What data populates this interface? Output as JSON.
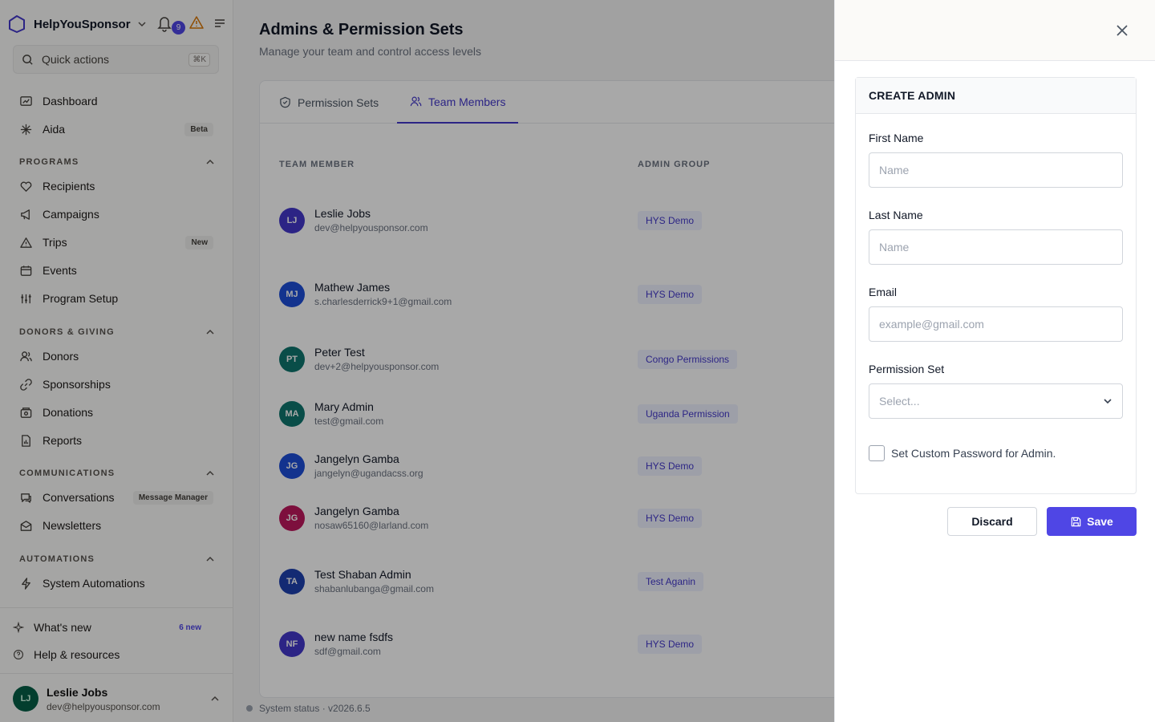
{
  "app": {
    "brand": "HelpYouSponsor",
    "notification_count": "9",
    "quick_actions": "Quick actions",
    "quick_actions_kbd": "⌘K"
  },
  "sidebar": {
    "top_items": [
      {
        "label": "Dashboard",
        "icon": "dashboard-icon"
      },
      {
        "label": "Aida",
        "icon": "sparkle-icon",
        "tag": "Beta"
      }
    ],
    "sections": [
      {
        "title": "PROGRAMS",
        "items": [
          {
            "label": "Recipients",
            "icon": "heart-icon"
          },
          {
            "label": "Campaigns",
            "icon": "megaphone-icon"
          },
          {
            "label": "Trips",
            "icon": "mountain-icon",
            "tag": "New"
          },
          {
            "label": "Events",
            "icon": "calendar-icon"
          },
          {
            "label": "Program Setup",
            "icon": "sliders-icon"
          }
        ]
      },
      {
        "title": "DONORS & GIVING",
        "items": [
          {
            "label": "Donors",
            "icon": "users-icon"
          },
          {
            "label": "Sponsorships",
            "icon": "link-icon"
          },
          {
            "label": "Donations",
            "icon": "donation-icon"
          },
          {
            "label": "Reports",
            "icon": "report-icon"
          }
        ]
      },
      {
        "title": "COMMUNICATIONS",
        "items": [
          {
            "label": "Conversations",
            "icon": "chat-icon",
            "tag": "Message Manager"
          },
          {
            "label": "Newsletters",
            "icon": "mail-icon"
          }
        ]
      },
      {
        "title": "AUTOMATIONS",
        "items": [
          {
            "label": "System Automations",
            "icon": "bolt-icon"
          }
        ]
      }
    ],
    "footer_items": [
      {
        "label": "What's new",
        "tag": "6 new"
      },
      {
        "label": "Help & resources"
      }
    ],
    "user": {
      "initials": "LJ",
      "name": "Leslie Jobs",
      "email": "dev@helpyousponsor.com"
    }
  },
  "main": {
    "title": "Admins & Permission Sets",
    "subtitle": "Manage your team and control access levels",
    "tabs": [
      {
        "label": "Permission Sets",
        "active": false
      },
      {
        "label": "Team Members",
        "active": true
      }
    ],
    "columns": [
      "TEAM MEMBER",
      "ADMIN GROUP"
    ],
    "rows": [
      {
        "initials": "LJ",
        "name": "Leslie Jobs",
        "email": "dev@helpyousponsor.com",
        "group": "HYS Demo",
        "color": "#4338ca"
      },
      {
        "initials": "MJ",
        "name": "Mathew James",
        "email": "s.charlesderrick9+1@gmail.com",
        "group": "HYS Demo",
        "color": "#1d4ed8"
      },
      {
        "initials": "PT",
        "name": "Peter Test",
        "email": "dev+2@helpyousponsor.com",
        "group": "Congo Permissions",
        "color": "#0f766e"
      },
      {
        "initials": "MA",
        "name": "Mary Admin",
        "email": "test@gmail.com",
        "group": "Uganda Permission",
        "color": "#0f766e"
      },
      {
        "initials": "JG",
        "name": "Jangelyn Gamba",
        "email": "jangelyn@ugandacss.org",
        "group": "HYS Demo",
        "color": "#1d4ed8"
      },
      {
        "initials": "JG",
        "name": "Jangelyn Gamba",
        "email": "nosaw65160@larland.com",
        "group": "HYS Demo",
        "color": "#be185d"
      },
      {
        "initials": "TA",
        "name": "Test Shaban Admin",
        "email": "shabanlubanga@gmail.com",
        "group": "Test Aganin",
        "color": "#1e40af"
      },
      {
        "initials": "NF",
        "name": "new name fsdfs",
        "email": "sdf@gmail.com",
        "group": "HYS Demo",
        "color": "#4338ca"
      }
    ],
    "status": "System status · v2026.6.5"
  },
  "drawer": {
    "card_title": "CREATE ADMIN",
    "fields": {
      "first_name": {
        "label": "First Name",
        "placeholder": "Name",
        "value": ""
      },
      "last_name": {
        "label": "Last Name",
        "placeholder": "Name",
        "value": ""
      },
      "email": {
        "label": "Email",
        "placeholder": "example@gmail.com",
        "value": ""
      },
      "permission_set": {
        "label": "Permission Set",
        "selected": "Select..."
      }
    },
    "custom_password_label": "Set Custom Password for Admin.",
    "discard_label": "Discard",
    "save_label": "Save"
  },
  "colors": {
    "accent": "#4f46e5",
    "brand_text": "#111827"
  }
}
